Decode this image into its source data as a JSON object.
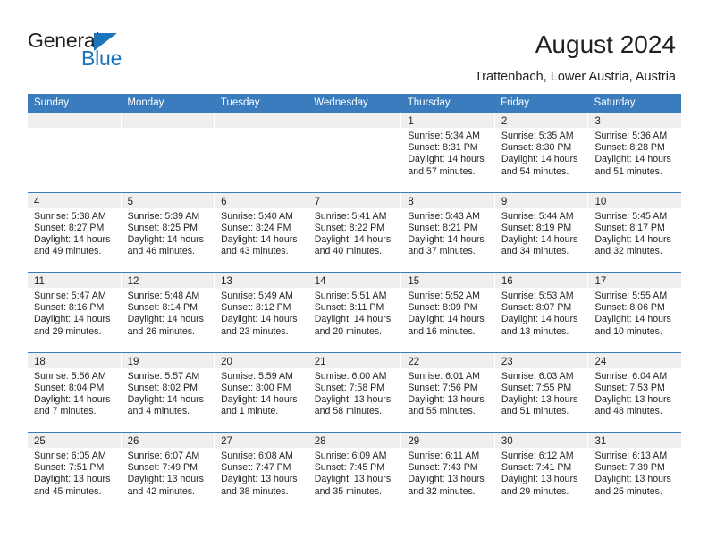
{
  "logo": {
    "word1": "General",
    "word2": "Blue",
    "triangle_color": "#1b75bb"
  },
  "header": {
    "title": "August 2024",
    "subtitle": "Trattenbach, Lower Austria, Austria"
  },
  "calendar": {
    "header_bg": "#3a7cbe",
    "daynum_bg": "#efefef",
    "day_names": [
      "Sunday",
      "Monday",
      "Tuesday",
      "Wednesday",
      "Thursday",
      "Friday",
      "Saturday"
    ],
    "labels": {
      "sunrise": "Sunrise:",
      "sunset": "Sunset:",
      "daylight": "Daylight:"
    },
    "weeks": [
      [
        {
          "day": ""
        },
        {
          "day": ""
        },
        {
          "day": ""
        },
        {
          "day": ""
        },
        {
          "day": "1",
          "sunrise": "Sunrise: 5:34 AM",
          "sunset": "Sunset: 8:31 PM",
          "daylight1": "Daylight: 14 hours",
          "daylight2": "and 57 minutes."
        },
        {
          "day": "2",
          "sunrise": "Sunrise: 5:35 AM",
          "sunset": "Sunset: 8:30 PM",
          "daylight1": "Daylight: 14 hours",
          "daylight2": "and 54 minutes."
        },
        {
          "day": "3",
          "sunrise": "Sunrise: 5:36 AM",
          "sunset": "Sunset: 8:28 PM",
          "daylight1": "Daylight: 14 hours",
          "daylight2": "and 51 minutes."
        }
      ],
      [
        {
          "day": "4",
          "sunrise": "Sunrise: 5:38 AM",
          "sunset": "Sunset: 8:27 PM",
          "daylight1": "Daylight: 14 hours",
          "daylight2": "and 49 minutes."
        },
        {
          "day": "5",
          "sunrise": "Sunrise: 5:39 AM",
          "sunset": "Sunset: 8:25 PM",
          "daylight1": "Daylight: 14 hours",
          "daylight2": "and 46 minutes."
        },
        {
          "day": "6",
          "sunrise": "Sunrise: 5:40 AM",
          "sunset": "Sunset: 8:24 PM",
          "daylight1": "Daylight: 14 hours",
          "daylight2": "and 43 minutes."
        },
        {
          "day": "7",
          "sunrise": "Sunrise: 5:41 AM",
          "sunset": "Sunset: 8:22 PM",
          "daylight1": "Daylight: 14 hours",
          "daylight2": "and 40 minutes."
        },
        {
          "day": "8",
          "sunrise": "Sunrise: 5:43 AM",
          "sunset": "Sunset: 8:21 PM",
          "daylight1": "Daylight: 14 hours",
          "daylight2": "and 37 minutes."
        },
        {
          "day": "9",
          "sunrise": "Sunrise: 5:44 AM",
          "sunset": "Sunset: 8:19 PM",
          "daylight1": "Daylight: 14 hours",
          "daylight2": "and 34 minutes."
        },
        {
          "day": "10",
          "sunrise": "Sunrise: 5:45 AM",
          "sunset": "Sunset: 8:17 PM",
          "daylight1": "Daylight: 14 hours",
          "daylight2": "and 32 minutes."
        }
      ],
      [
        {
          "day": "11",
          "sunrise": "Sunrise: 5:47 AM",
          "sunset": "Sunset: 8:16 PM",
          "daylight1": "Daylight: 14 hours",
          "daylight2": "and 29 minutes."
        },
        {
          "day": "12",
          "sunrise": "Sunrise: 5:48 AM",
          "sunset": "Sunset: 8:14 PM",
          "daylight1": "Daylight: 14 hours",
          "daylight2": "and 26 minutes."
        },
        {
          "day": "13",
          "sunrise": "Sunrise: 5:49 AM",
          "sunset": "Sunset: 8:12 PM",
          "daylight1": "Daylight: 14 hours",
          "daylight2": "and 23 minutes."
        },
        {
          "day": "14",
          "sunrise": "Sunrise: 5:51 AM",
          "sunset": "Sunset: 8:11 PM",
          "daylight1": "Daylight: 14 hours",
          "daylight2": "and 20 minutes."
        },
        {
          "day": "15",
          "sunrise": "Sunrise: 5:52 AM",
          "sunset": "Sunset: 8:09 PM",
          "daylight1": "Daylight: 14 hours",
          "daylight2": "and 16 minutes."
        },
        {
          "day": "16",
          "sunrise": "Sunrise: 5:53 AM",
          "sunset": "Sunset: 8:07 PM",
          "daylight1": "Daylight: 14 hours",
          "daylight2": "and 13 minutes."
        },
        {
          "day": "17",
          "sunrise": "Sunrise: 5:55 AM",
          "sunset": "Sunset: 8:06 PM",
          "daylight1": "Daylight: 14 hours",
          "daylight2": "and 10 minutes."
        }
      ],
      [
        {
          "day": "18",
          "sunrise": "Sunrise: 5:56 AM",
          "sunset": "Sunset: 8:04 PM",
          "daylight1": "Daylight: 14 hours",
          "daylight2": "and 7 minutes."
        },
        {
          "day": "19",
          "sunrise": "Sunrise: 5:57 AM",
          "sunset": "Sunset: 8:02 PM",
          "daylight1": "Daylight: 14 hours",
          "daylight2": "and 4 minutes."
        },
        {
          "day": "20",
          "sunrise": "Sunrise: 5:59 AM",
          "sunset": "Sunset: 8:00 PM",
          "daylight1": "Daylight: 14 hours",
          "daylight2": "and 1 minute."
        },
        {
          "day": "21",
          "sunrise": "Sunrise: 6:00 AM",
          "sunset": "Sunset: 7:58 PM",
          "daylight1": "Daylight: 13 hours",
          "daylight2": "and 58 minutes."
        },
        {
          "day": "22",
          "sunrise": "Sunrise: 6:01 AM",
          "sunset": "Sunset: 7:56 PM",
          "daylight1": "Daylight: 13 hours",
          "daylight2": "and 55 minutes."
        },
        {
          "day": "23",
          "sunrise": "Sunrise: 6:03 AM",
          "sunset": "Sunset: 7:55 PM",
          "daylight1": "Daylight: 13 hours",
          "daylight2": "and 51 minutes."
        },
        {
          "day": "24",
          "sunrise": "Sunrise: 6:04 AM",
          "sunset": "Sunset: 7:53 PM",
          "daylight1": "Daylight: 13 hours",
          "daylight2": "and 48 minutes."
        }
      ],
      [
        {
          "day": "25",
          "sunrise": "Sunrise: 6:05 AM",
          "sunset": "Sunset: 7:51 PM",
          "daylight1": "Daylight: 13 hours",
          "daylight2": "and 45 minutes."
        },
        {
          "day": "26",
          "sunrise": "Sunrise: 6:07 AM",
          "sunset": "Sunset: 7:49 PM",
          "daylight1": "Daylight: 13 hours",
          "daylight2": "and 42 minutes."
        },
        {
          "day": "27",
          "sunrise": "Sunrise: 6:08 AM",
          "sunset": "Sunset: 7:47 PM",
          "daylight1": "Daylight: 13 hours",
          "daylight2": "and 38 minutes."
        },
        {
          "day": "28",
          "sunrise": "Sunrise: 6:09 AM",
          "sunset": "Sunset: 7:45 PM",
          "daylight1": "Daylight: 13 hours",
          "daylight2": "and 35 minutes."
        },
        {
          "day": "29",
          "sunrise": "Sunrise: 6:11 AM",
          "sunset": "Sunset: 7:43 PM",
          "daylight1": "Daylight: 13 hours",
          "daylight2": "and 32 minutes."
        },
        {
          "day": "30",
          "sunrise": "Sunrise: 6:12 AM",
          "sunset": "Sunset: 7:41 PM",
          "daylight1": "Daylight: 13 hours",
          "daylight2": "and 29 minutes."
        },
        {
          "day": "31",
          "sunrise": "Sunrise: 6:13 AM",
          "sunset": "Sunset: 7:39 PM",
          "daylight1": "Daylight: 13 hours",
          "daylight2": "and 25 minutes."
        }
      ]
    ]
  }
}
